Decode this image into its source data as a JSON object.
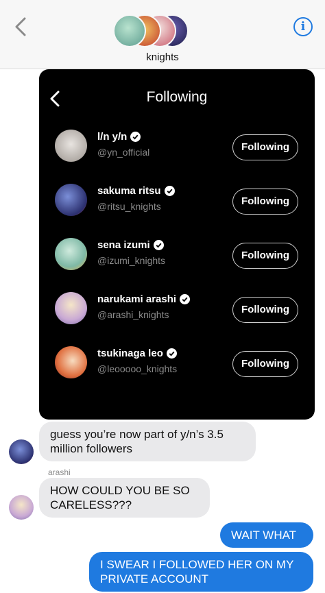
{
  "header": {
    "group_name": "knights",
    "back_icon": "chevron-left-icon",
    "info_icon": "info-icon",
    "info_glyph": "i"
  },
  "following_card": {
    "title": "Following",
    "accounts": [
      {
        "name": "l/n y/n",
        "handle": "@yn_official",
        "button": "Following",
        "avatar_colors": [
          "#d9d4cf",
          "#8c8580"
        ]
      },
      {
        "name": "sakuma ritsu",
        "handle": "@ritsu_knights",
        "button": "Following",
        "avatar_colors": [
          "#5a6fb8",
          "#c84050"
        ]
      },
      {
        "name": "sena izumi",
        "handle": "@izumi_knights",
        "button": "Following",
        "avatar_colors": [
          "#8fc7b4",
          "#e3b04a"
        ]
      },
      {
        "name": "narukami arashi",
        "handle": "@arashi_knights",
        "button": "Following",
        "avatar_colors": [
          "#c9a9d4",
          "#f0d08a"
        ]
      },
      {
        "name": "tsukinaga leo",
        "handle": "@leooooo_knights",
        "button": "Following",
        "avatar_colors": [
          "#e07040",
          "#f3c05a"
        ]
      }
    ]
  },
  "messages": [
    {
      "direction": "incoming",
      "text": "guess you’re now part of y/n’s 3.5 million followers"
    },
    {
      "direction": "incoming",
      "sender": "arashi",
      "text": "HOW COULD YOU BE SO CARELESS???"
    },
    {
      "direction": "outgoing",
      "text": "WAIT WHAT"
    },
    {
      "direction": "outgoing",
      "text": "I SWEAR I FOLLOWED HER ON MY PRIVATE ACCOUNT"
    }
  ],
  "colors": {
    "accent": "#1f7ae0",
    "incoming_bubble": "#e9e9eb",
    "card": "#000000"
  }
}
